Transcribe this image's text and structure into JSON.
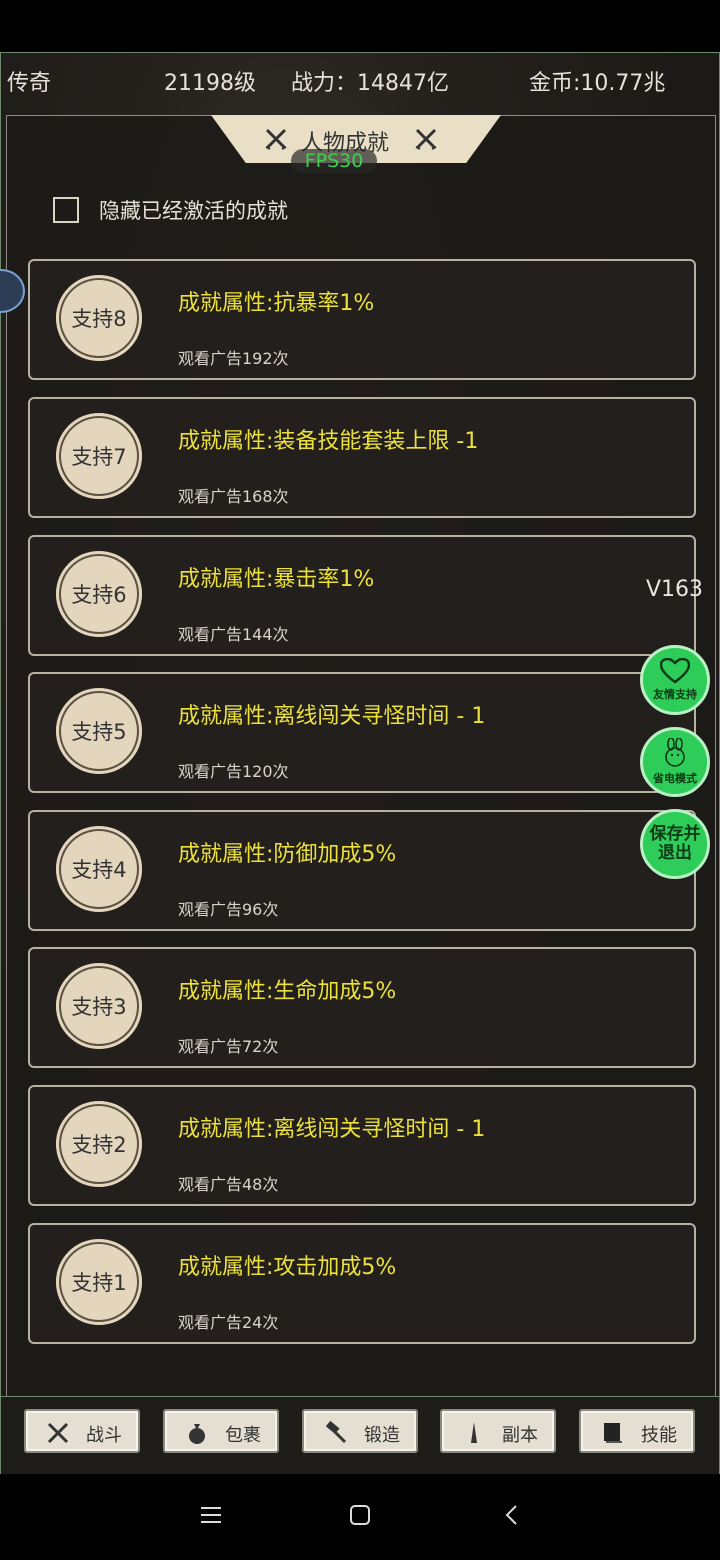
{
  "header": {
    "name": "传奇",
    "level": "21198级",
    "power": "战力：14847亿",
    "gold": "金币:10.77兆"
  },
  "panel": {
    "title": "人物成就",
    "fps": "FPS30",
    "hide_label": "隐藏已经激活的成就"
  },
  "achievements": [
    {
      "badge": "支持8",
      "title": "成就属性:抗暴率1%",
      "sub": "观看广告192次"
    },
    {
      "badge": "支持7",
      "title": "成就属性:装备技能套装上限 -1",
      "sub": "观看广告168次"
    },
    {
      "badge": "支持6",
      "title": "成就属性:暴击率1%",
      "sub": "观看广告144次"
    },
    {
      "badge": "支持5",
      "title": "成就属性:离线闯关寻怪时间 - 1",
      "sub": "观看广告120次"
    },
    {
      "badge": "支持4",
      "title": "成就属性:防御加成5%",
      "sub": "观看广告96次"
    },
    {
      "badge": "支持3",
      "title": "成就属性:生命加成5%",
      "sub": "观看广告72次"
    },
    {
      "badge": "支持2",
      "title": "成就属性:离线闯关寻怪时间 - 1",
      "sub": "观看广告48次"
    },
    {
      "badge": "支持1",
      "title": "成就属性:攻击加成5%",
      "sub": "观看广告24次"
    }
  ],
  "version": "V163",
  "float_buttons": {
    "friend": "友情支持",
    "power_save": "省电模式",
    "save_exit_1": "保存并",
    "save_exit_2": "退出"
  },
  "nav": {
    "battle": "战斗",
    "bag": "包裹",
    "forge": "锻造",
    "dungeon": "副本",
    "skill": "技能"
  },
  "colors": {
    "achievement_title": "#ece13a",
    "fps": "#3bd04e",
    "float_button": "#2ecc58"
  }
}
